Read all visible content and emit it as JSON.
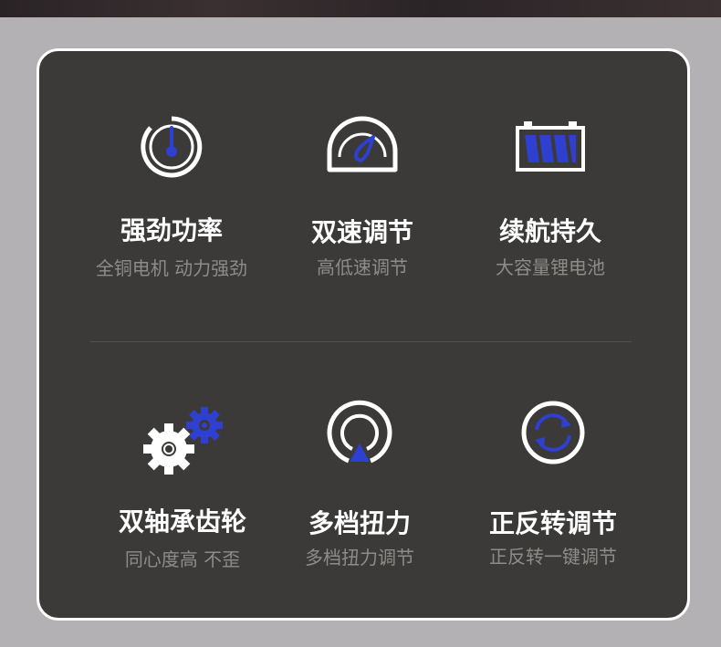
{
  "features": [
    {
      "title": "强劲功率",
      "subtitle": "全铜电机 动力强劲",
      "icon": "power-gauge-icon"
    },
    {
      "title": "双速调节",
      "subtitle": "高低速调节",
      "icon": "speedometer-icon"
    },
    {
      "title": "续航持久",
      "subtitle": "大容量锂电池",
      "icon": "battery-icon"
    },
    {
      "title": "双轴承齿轮",
      "subtitle": "同心度高 不歪",
      "icon": "gears-icon"
    },
    {
      "title": "多档扭力",
      "subtitle": "多档扭力调节",
      "icon": "torque-signal-icon"
    },
    {
      "title": "正反转调节",
      "subtitle": "正反转一键调节",
      "icon": "reverse-rotation-icon"
    }
  ],
  "colors": {
    "background": "#b3b1b4",
    "card": "#3b3a38",
    "accent_blue": "#2f3fcf",
    "text_primary": "#ffffff",
    "text_secondary": "#8e8c89"
  }
}
